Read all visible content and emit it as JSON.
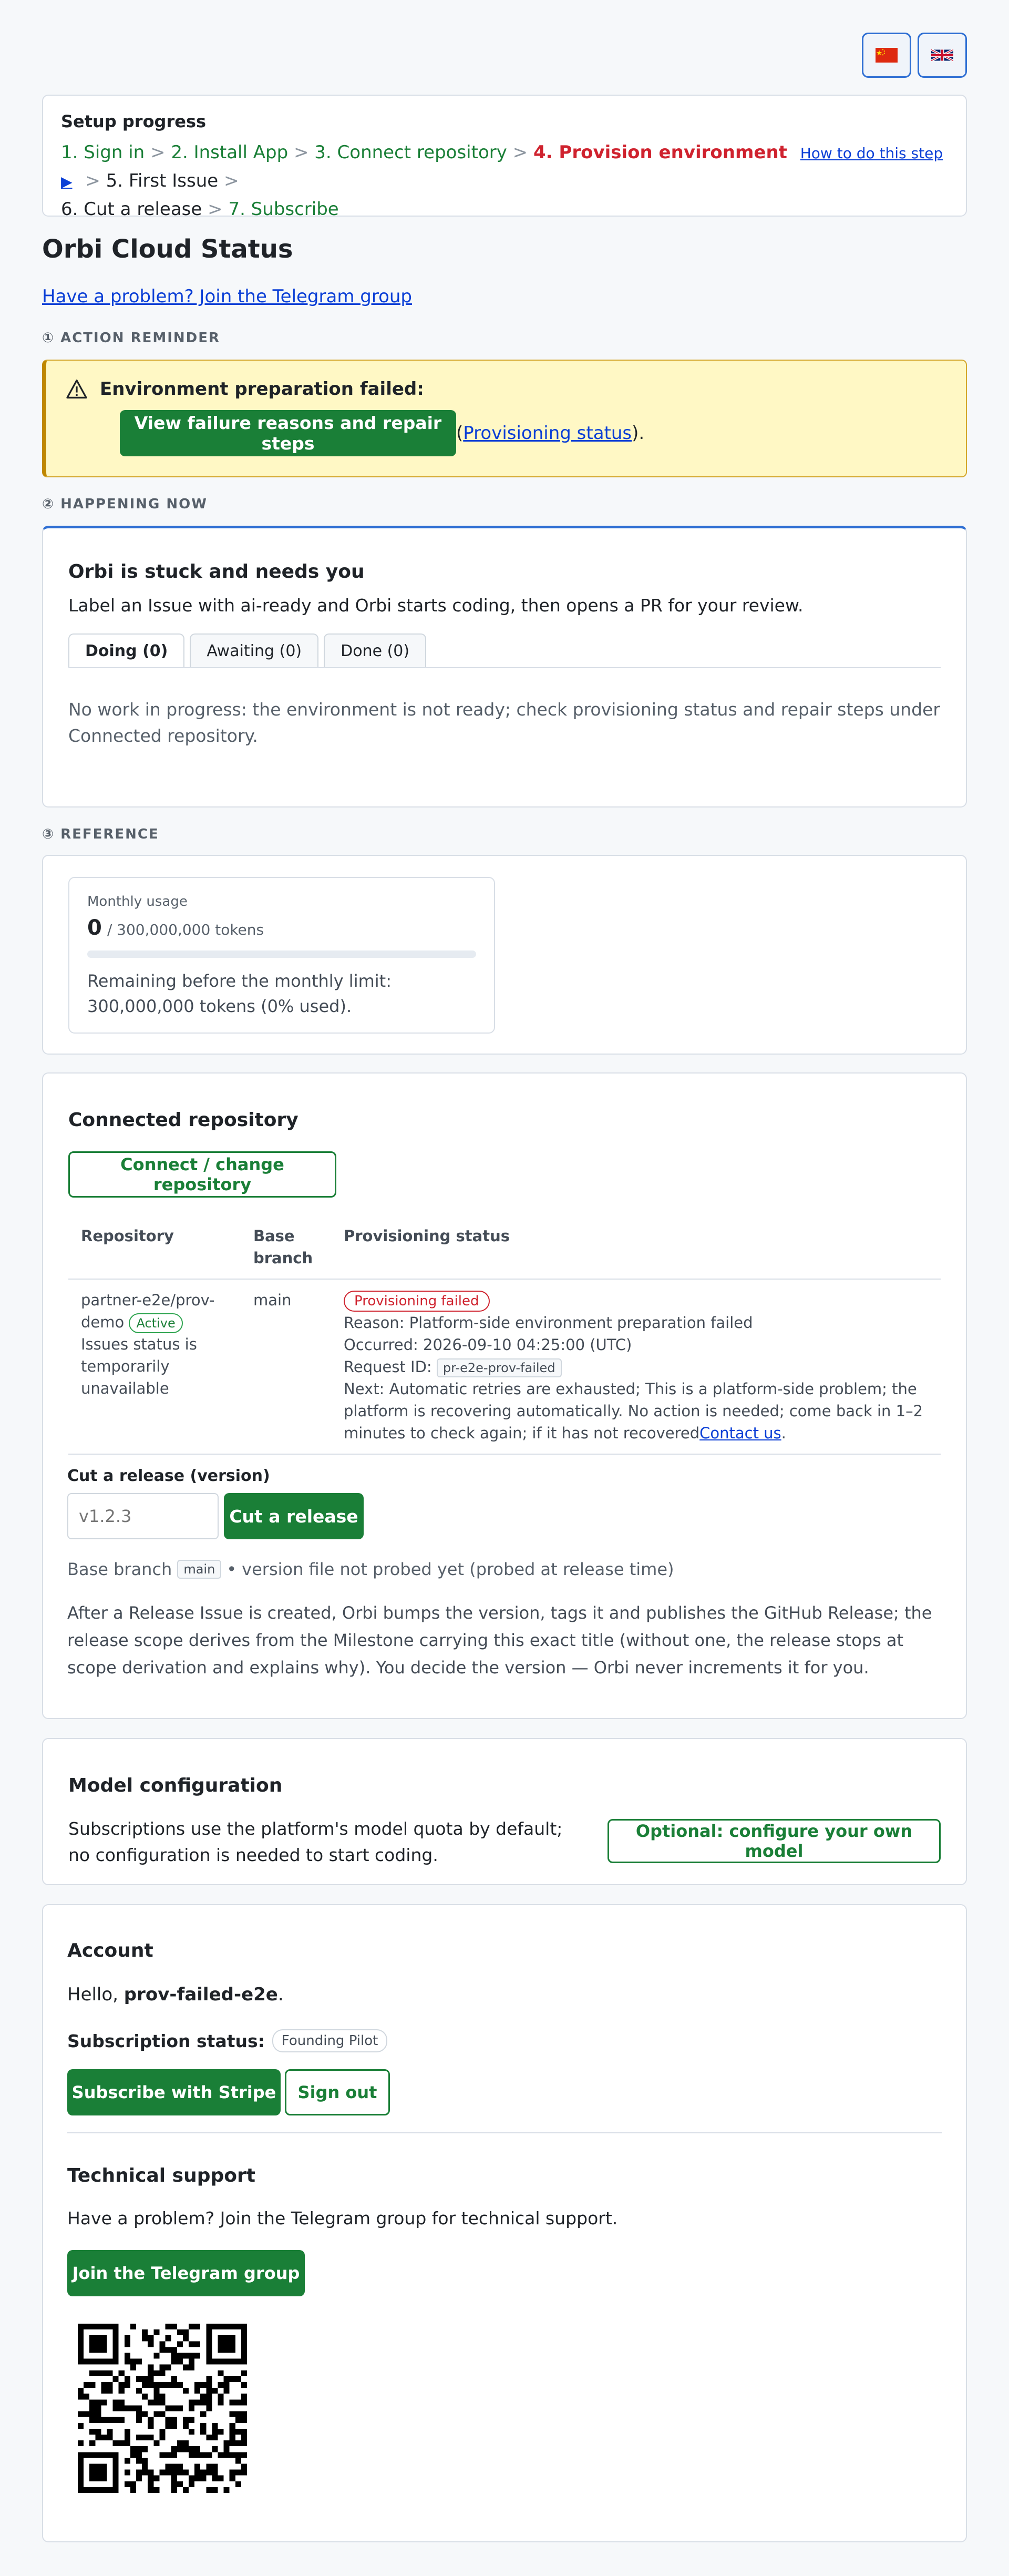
{
  "languages": [
    {
      "name": "Chinese",
      "icon": "china-flag-icon"
    },
    {
      "name": "English",
      "icon": "uk-flag-icon"
    }
  ],
  "setup": {
    "title": "Setup progress",
    "steps_done": [
      "1. Sign in",
      "2. Install App",
      "3. Connect repository"
    ],
    "current_step": "4. Provision environment",
    "howto_link": "How to do this step ▶",
    "steps_next": [
      "5. First Issue",
      "6. Cut a release"
    ],
    "last_step": "7. Subscribe",
    "separator": ">"
  },
  "page": {
    "title": "Orbi Cloud Status",
    "telegram_link": "Have a problem? Join the Telegram group"
  },
  "sections": {
    "action": "① ACTION REMINDER",
    "now": "② HAPPENING NOW",
    "reference": "③ REFERENCE"
  },
  "alert": {
    "icon": "warning-icon",
    "title": "Environment preparation failed:",
    "button": "View failure reasons and repair steps",
    "paren_open": "(",
    "link": "Provisioning status",
    "paren_close": ")."
  },
  "now": {
    "title": "Orbi is stuck and needs you",
    "desc": "Label an Issue with ai-ready and Orbi starts coding, then opens a PR for your review.",
    "tabs": [
      "Doing (0)",
      "Awaiting (0)",
      "Done (0)"
    ],
    "empty": "No work in progress: the environment is not ready; check provisioning status and repair steps under Connected repository."
  },
  "usage": {
    "label": "Monthly usage",
    "used": "0",
    "limit": "/ 300,000,000 tokens",
    "used_fraction": 0,
    "remaining": "Remaining before the monthly limit: 300,000,000 tokens (0% used)."
  },
  "repo": {
    "title": "Connected repository",
    "connect_button": "Connect / change repository",
    "headers": [
      "Repository",
      "Base branch",
      "Provisioning status"
    ],
    "row": {
      "name": "partner-e2e/prov-demo",
      "active": "Active",
      "issues_note": "Issues status is temporarily unavailable",
      "branch": "main",
      "status_badge": "Provisioning failed",
      "reason": "Reason: Platform-side environment preparation failed",
      "occurred": "Occurred: 2026-09-10 04:25:00 (UTC)",
      "request_label": "Request ID:",
      "request_id": "pr-e2e-prov-failed",
      "next": "Next: Automatic retries are exhausted; This is a platform-side problem; the platform is recovering automatically. No action is needed; come back in 1–2 minutes to check again; if it has not recovered",
      "contact": "Contact us",
      "contact_tail": "."
    },
    "release": {
      "label": "Cut a release (version)",
      "placeholder": "v1.2.3",
      "button": "Cut a release",
      "base_prefix": "Base branch",
      "base_branch": "main",
      "bullet": "•",
      "probe_note": "version file not probed yet (probed at release time)",
      "note": "After a Release Issue is created, Orbi bumps the version, tags it and publishes the GitHub Release; the release scope derives from the Milestone carrying this exact title (without one, the release stops at scope derivation and explains why). You decide the version — Orbi never increments it for you."
    }
  },
  "model": {
    "title": "Model configuration",
    "desc": "Subscriptions use the platform's model quota by default; no configuration is needed to start coding.",
    "button": "Optional: configure your own model"
  },
  "account": {
    "title": "Account",
    "hello_prefix": "Hello, ",
    "username": "prov-failed-e2e",
    "hello_suffix": ".",
    "sub_label": "Subscription status:",
    "sub_value": "Founding Pilot",
    "stripe_button": "Subscribe with Stripe",
    "signout_button": "Sign out"
  },
  "support": {
    "title": "Technical support",
    "desc": "Have a problem? Join the Telegram group for technical support.",
    "button": "Join the Telegram group",
    "qr_icon": "qr-code-icon"
  },
  "colors": {
    "green": "#1a7f37",
    "red": "#cf222e",
    "blue": "#2f6fd3",
    "alert_bg": "#fff8c5"
  }
}
